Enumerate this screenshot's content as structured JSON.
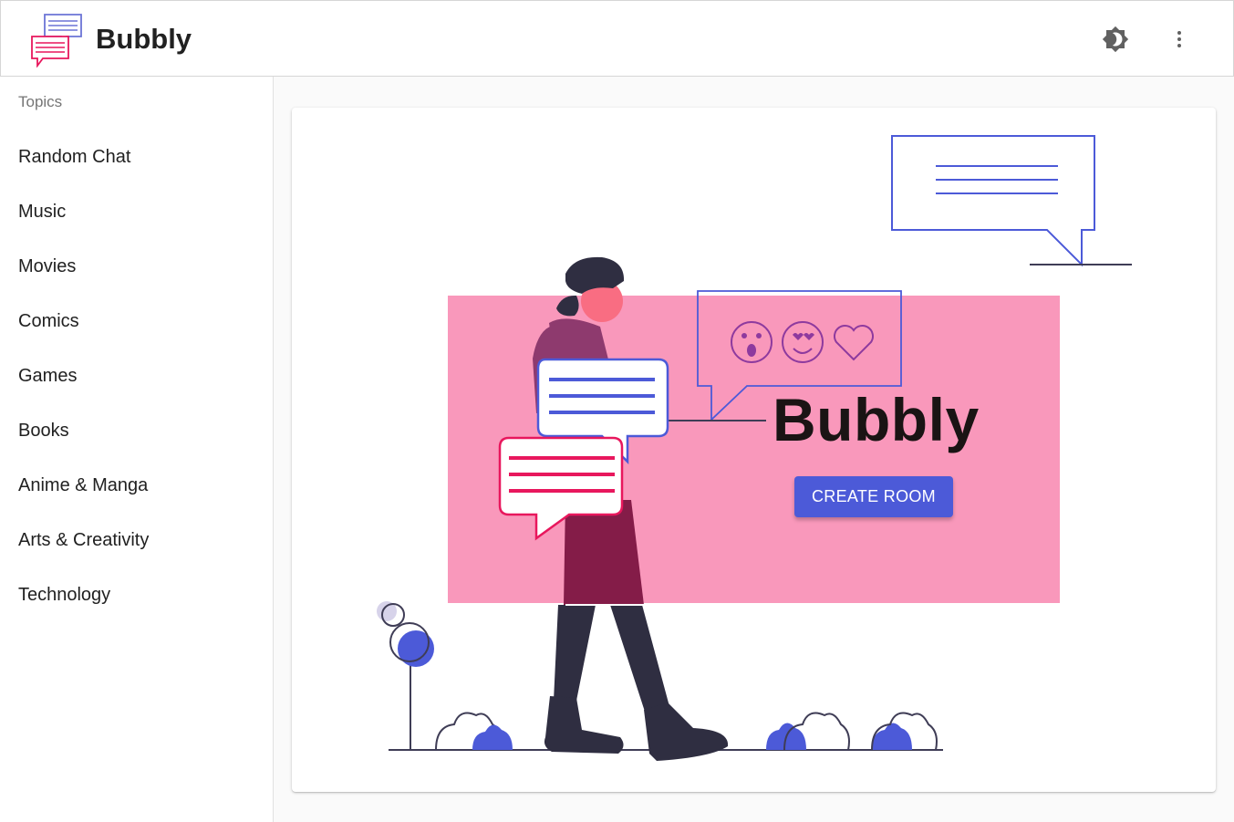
{
  "app": {
    "title": "Bubbly",
    "logo_icon": "chat-bubbles-logo-icon",
    "theme_icon": "brightness-icon",
    "menu_icon": "more-vert-icon"
  },
  "sidebar": {
    "header": "Topics",
    "items": [
      {
        "label": "Random Chat"
      },
      {
        "label": "Music"
      },
      {
        "label": "Movies"
      },
      {
        "label": "Comics"
      },
      {
        "label": "Games"
      },
      {
        "label": "Books"
      },
      {
        "label": "Anime & Manga"
      },
      {
        "label": "Arts & Creativity"
      },
      {
        "label": "Technology"
      }
    ]
  },
  "hero": {
    "title": "Bubbly",
    "button_label": "CREATE ROOM"
  },
  "colors": {
    "accent": "#4c5ad8",
    "banner": "#f998bb",
    "pink": "#e8175d"
  }
}
